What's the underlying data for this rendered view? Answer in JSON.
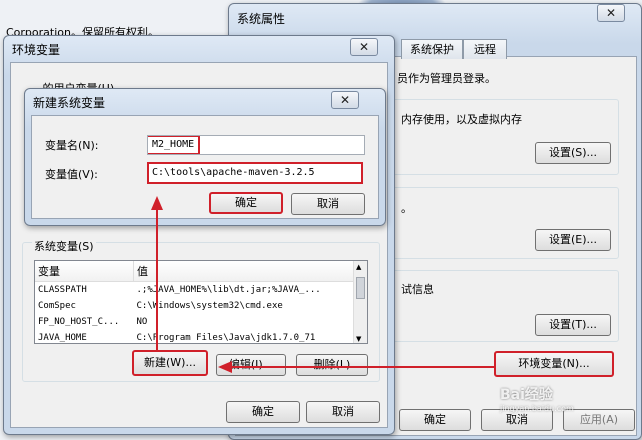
{
  "background": {
    "copyright_text": "Corporation。保留所有权利。"
  },
  "system_properties": {
    "title": "系统属性",
    "tabs": [
      "系统保护",
      "远程"
    ],
    "admin_note": "员作为管理员登录。",
    "performance_text": "内存使用，以及虚拟内存",
    "settings_s": "设置(S)...",
    "settings_e": "设置(E)...",
    "debug_text": "试信息",
    "settings_t": "设置(T)...",
    "env_vars_button": "环境变量(N)...",
    "ok": "确定",
    "cancel": "取消",
    "apply": "应用(A)"
  },
  "env_vars": {
    "title": "环境变量",
    "user_vars_label": "...的用户变量(U)",
    "system_vars_label": "系统变量(S)",
    "columns": [
      "变量",
      "值"
    ],
    "rows": [
      {
        "name": "CLASSPATH",
        "value": ".;%JAVA_HOME%\\lib\\dt.jar;%JAVA_..."
      },
      {
        "name": "ComSpec",
        "value": "C:\\Windows\\system32\\cmd.exe"
      },
      {
        "name": "FP_NO_HOST_C...",
        "value": "NO"
      },
      {
        "name": "JAVA_HOME",
        "value": "C:\\Program Files\\Java\\jdk1.7.0_71"
      }
    ],
    "new_button": "新建(W)...",
    "edit_button": "编辑(I)...",
    "delete_button": "删除(L)",
    "ok": "确定",
    "cancel": "取消"
  },
  "new_sys_var": {
    "title": "新建系统变量",
    "name_label": "变量名(N):",
    "name_value": "M2_HOME",
    "value_label": "变量值(V):",
    "value_value": "C:\\tools\\apache-maven-3.2.5",
    "ok": "确定",
    "cancel": "取消"
  },
  "watermark": {
    "text": "Bai经验",
    "sub": "jingyan.baidu.com"
  },
  "colors": {
    "annotation_red": "#d0202a"
  }
}
